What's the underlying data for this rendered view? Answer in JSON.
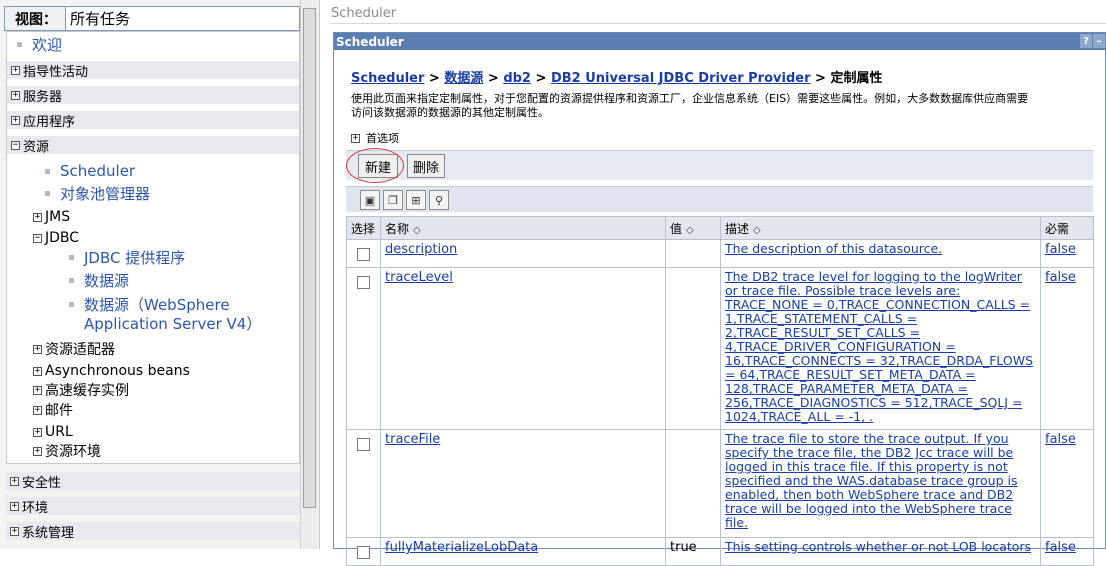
{
  "nav": {
    "view_label": "视图：",
    "view_value": "所有任务",
    "welcome": "欢迎",
    "categories_top": [
      {
        "label": "指导性活动",
        "expander": "⊞"
      },
      {
        "label": "服务器",
        "expander": "⊞"
      },
      {
        "label": "应用程序",
        "expander": "⊞"
      }
    ],
    "resources": {
      "label": "资源",
      "expander": "⊟"
    },
    "resource_items": [
      "Scheduler",
      "对象池管理器"
    ],
    "jms": {
      "label": "JMS",
      "expander": "⊞"
    },
    "jdbc": {
      "label": "JDBC",
      "expander": "⊟"
    },
    "jdbc_items": [
      "JDBC 提供程序",
      "数据源",
      "数据源（WebSphere",
      "Application Server V4）"
    ],
    "other_items": [
      {
        "label": "资源适配器",
        "expander": "⊞"
      },
      {
        "label": "Asynchronous beans",
        "expander": "⊞"
      },
      {
        "label": "高速缓存实例",
        "expander": "⊞"
      },
      {
        "label": "邮件",
        "expander": "⊞"
      },
      {
        "label": "URL",
        "expander": "⊞"
      },
      {
        "label": "资源环境",
        "expander": "⊞"
      }
    ],
    "categories_bottom": [
      {
        "label": "安全性",
        "expander": "⊞"
      },
      {
        "label": "环境",
        "expander": "⊞"
      },
      {
        "label": "系统管理",
        "expander": "⊞"
      }
    ]
  },
  "main": {
    "top_crumb": "Scheduler",
    "portlet_title": "Scheduler",
    "portlet_help": "?",
    "portlet_min": "–",
    "breadcrumb": {
      "links": [
        "Scheduler",
        "数据源",
        "db2",
        "DB2 Universal JDBC Driver Provider"
      ],
      "separator": " > ",
      "current": "定制属性"
    },
    "description_line1": "使用此页面来指定定制属性，对于您配置的资源提供程序和资源工厂，企业信息系统（EIS）需要这些属性。例如，大多数数据库供应商需要",
    "description_line2": "访问该数据源的数据源的其他定制属性。",
    "preferences": "首选项",
    "buttons": {
      "new": "新建",
      "delete": "删除"
    },
    "table": {
      "headers": {
        "select": "选择",
        "name": "名称",
        "value": "值",
        "description": "描述",
        "required": "必需"
      },
      "sort_icon": "◇",
      "rows": [
        {
          "name": "description",
          "value": "",
          "description": "The description of this datasource.",
          "required": "false"
        },
        {
          "name": "traceLevel",
          "value": "",
          "description": "The DB2 trace level for logging to the logWriter or trace file. Possible trace levels are: TRACE_NONE = 0,TRACE_CONNECTION_CALLS = 1,TRACE_STATEMENT_CALLS = 2,TRACE_RESULT_SET_CALLS = 4,TRACE_DRIVER_CONFIGURATION = 16,TRACE_CONNECTS = 32,TRACE_DRDA_FLOWS = 64,TRACE_RESULT_SET_META_DATA = 128,TRACE_PARAMETER_META_DATA = 256,TRACE_DIAGNOSTICS = 512,TRACE_SQLJ = 1024,TRACE_ALL = -1, .",
          "required": "false"
        },
        {
          "name": "traceFile",
          "value": "",
          "description": "The trace file to store the trace output. If you specify the trace file, the DB2 Jcc trace will be logged in this trace file. If this property is not specified and the WAS.database trace group is enabled, then both WebSphere trace and DB2 trace will be logged into the WebSphere trace file.",
          "required": "false"
        },
        {
          "name": "fullyMaterializeLobData",
          "value": "true",
          "description": "This setting controls whether or not LOB locators",
          "required": "false"
        }
      ]
    }
  }
}
